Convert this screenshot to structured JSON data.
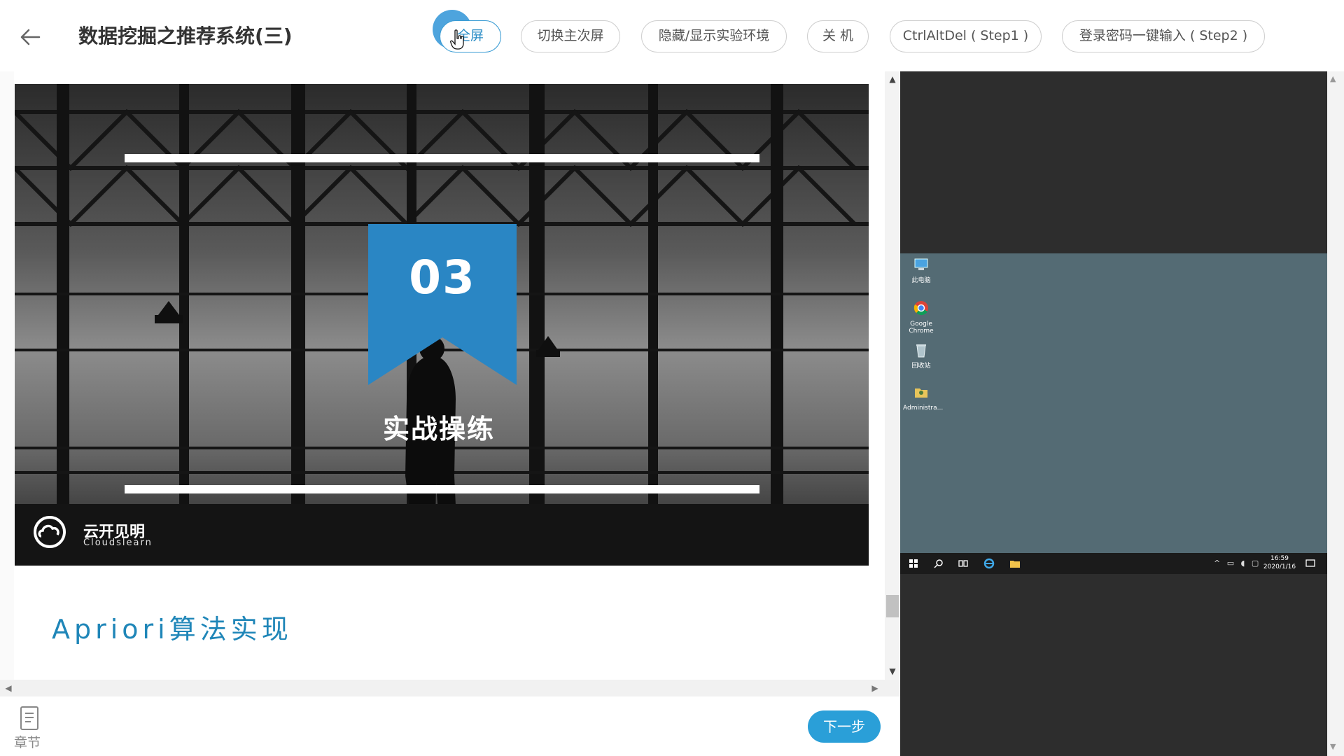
{
  "header": {
    "title": "数据挖掘之推荐系统(三)",
    "buttons": {
      "fullscreen": "全屏",
      "switch_screen": "切换主次屏",
      "toggle_env": "隐藏/显示实验环境",
      "shutdown": "关 机",
      "ctrl_alt_del": "CtrlAltDel ( Step1 )",
      "password_input": "登录密码一键输入 ( Step2 )"
    }
  },
  "slide": {
    "number": "03",
    "caption": "实战操练",
    "logo_cn": "云开见明",
    "logo_en": "Cloudslearn",
    "ribbon_color": "#2a86c4"
  },
  "content": {
    "section_heading": "Apriori算法实现"
  },
  "footer": {
    "chapter_label": "章节",
    "next_label": "下一步"
  },
  "vm": {
    "desktop_icons": [
      {
        "label": "此电脑",
        "icon": "computer-icon"
      },
      {
        "label": "Google Chrome",
        "icon": "chrome-icon"
      },
      {
        "label": "回收站",
        "icon": "recycle-bin-icon"
      },
      {
        "label": "Administra...",
        "icon": "user-folder-icon"
      }
    ],
    "clock_time": "16:59",
    "clock_date": "2020/1/16"
  },
  "colors": {
    "accent": "#2a9fd8",
    "heading": "#1f86b8",
    "vm_desktop": "#546b74"
  }
}
